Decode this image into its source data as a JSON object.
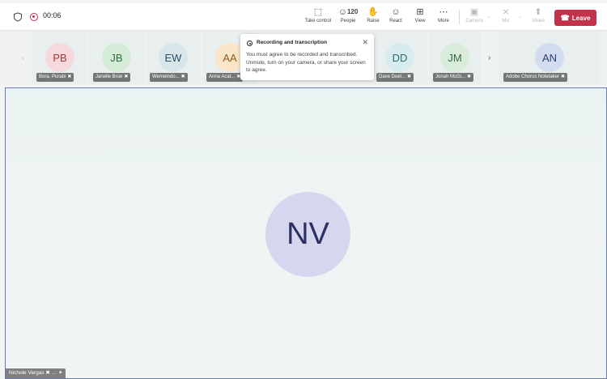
{
  "toolbar": {
    "timer": "00:06",
    "buttons": [
      {
        "label": "Take control",
        "icon": "take-control-icon"
      },
      {
        "label": "People",
        "icon": "people-icon",
        "count": "120"
      },
      {
        "label": "Raise",
        "icon": "raise-hand-icon"
      },
      {
        "label": "React",
        "icon": "react-icon"
      },
      {
        "label": "View",
        "icon": "view-icon"
      },
      {
        "label": "More",
        "icon": "more-icon"
      },
      {
        "label": "Camera",
        "icon": "camera-off-icon"
      },
      {
        "label": "Mic",
        "icon": "mic-off-icon"
      },
      {
        "label": "Share",
        "icon": "share-icon"
      }
    ],
    "leave_label": "Leave"
  },
  "participants": [
    {
      "initials": "PB",
      "name": "Bora, Purabi",
      "bg": "#f6d9dc",
      "fg": "#a4373a"
    },
    {
      "initials": "JB",
      "name": "Janelle Brue",
      "bg": "#d5ecd8",
      "fg": "#2f6f3a"
    },
    {
      "initials": "EW",
      "name": "Wemeindo...",
      "bg": "#d8e6ea",
      "fg": "#2f4f5f"
    },
    {
      "initials": "AA",
      "name": "Anna Acat...",
      "bg": "#fbe5c8",
      "fg": "#8a5a1c"
    },
    {
      "initials": "DD",
      "name": "Dave Duel...",
      "bg": "#d6ecef",
      "fg": "#2c6b74"
    },
    {
      "initials": "JM",
      "name": "Jonah McGi...",
      "bg": "#d9ebdb",
      "fg": "#356b3c"
    },
    {
      "initials": "AN",
      "name": "Adobe Chorus Notetaker",
      "bg": "#d3dcef",
      "fg": "#2a3d75"
    }
  ],
  "popup": {
    "title": "Recording and transcription",
    "body": "You must agree to be recorded and transcribed. Unmute, turn on your camera, or share your screen to agree."
  },
  "main": {
    "initials": "NV",
    "name": "Nichole Vargas"
  }
}
